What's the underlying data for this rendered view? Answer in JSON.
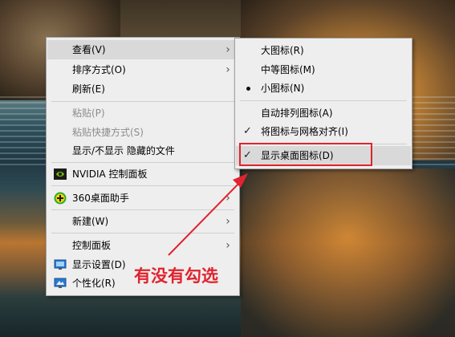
{
  "main_menu": {
    "items": [
      {
        "label": "查看(V)"
      },
      {
        "label": "排序方式(O)"
      },
      {
        "label": "刷新(E)"
      },
      {
        "label": "粘贴(P)"
      },
      {
        "label": "粘贴快捷方式(S)"
      },
      {
        "label": "显示/不显示 隐藏的文件"
      },
      {
        "label": "NVIDIA 控制面板",
        "icon": "nvidia-icon"
      },
      {
        "label": "360桌面助手",
        "icon": "360-plus-icon"
      },
      {
        "label": "新建(W)"
      },
      {
        "label": "控制面板"
      },
      {
        "label": "显示设置(D)",
        "icon": "display-settings-icon"
      },
      {
        "label": "个性化(R)",
        "icon": "personalize-icon"
      }
    ]
  },
  "view_submenu": {
    "items": [
      {
        "label": "大图标(R)"
      },
      {
        "label": "中等图标(M)"
      },
      {
        "label": "小图标(N)",
        "state": "radio-selected"
      },
      {
        "label": "自动排列图标(A)"
      },
      {
        "label": "将图标与网格对齐(I)",
        "state": "checked"
      },
      {
        "label": "显示桌面图标(D)",
        "state": "checked"
      }
    ]
  },
  "annotation": {
    "text": "有没有勾选",
    "color": "#e0232d"
  },
  "colors": {
    "menu_bg": "#eeeeee",
    "highlight": "#d9d9d9",
    "accent_red": "#e0232d"
  }
}
